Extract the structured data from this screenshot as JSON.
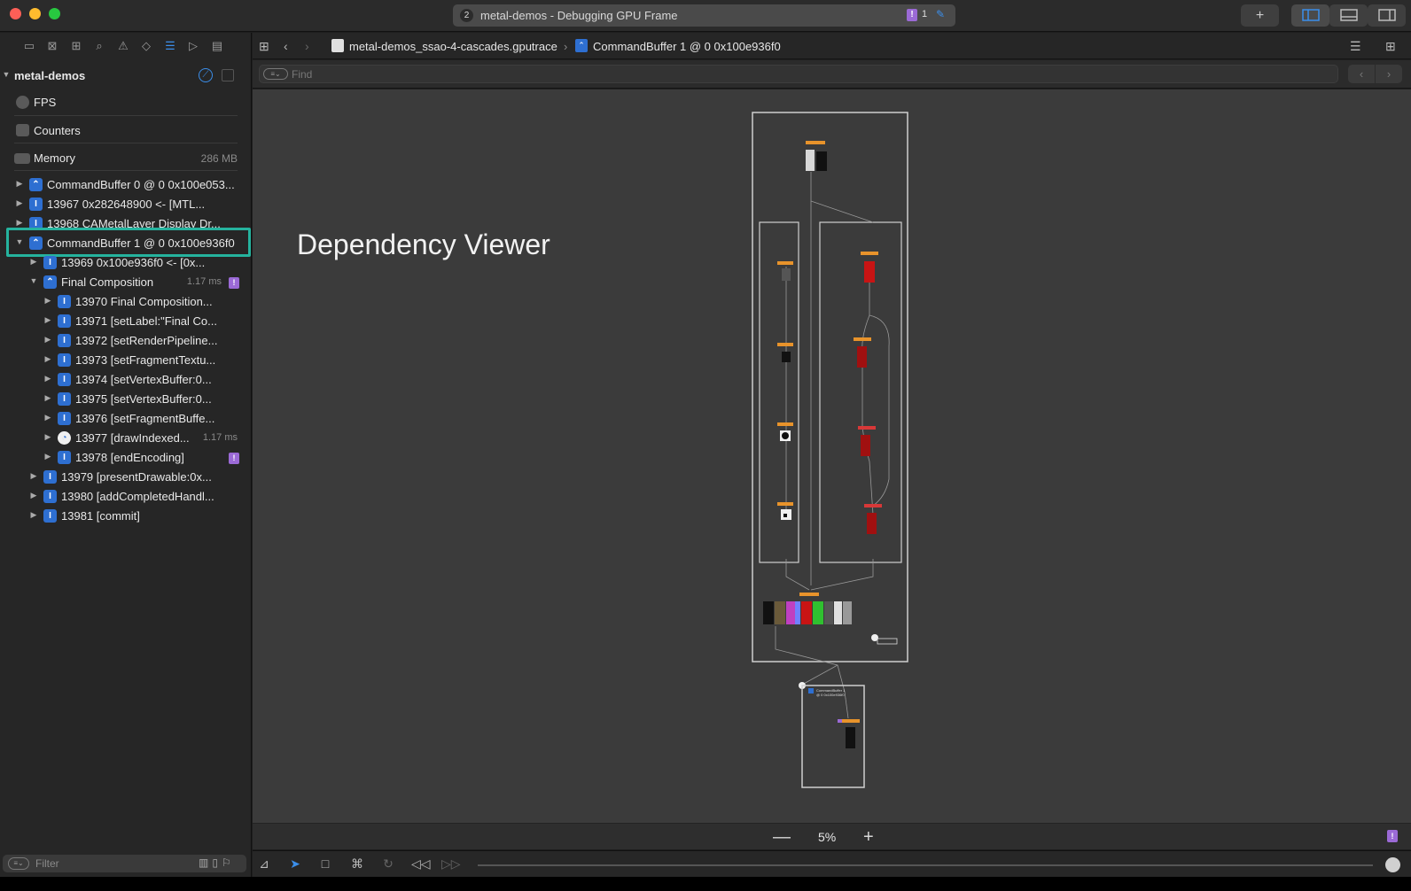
{
  "window": {
    "tab_number": "2",
    "title": "metal-demos - Debugging GPU Frame",
    "issue_count": "1"
  },
  "sidebar": {
    "root_label": "metal-demos",
    "fps_label": "FPS",
    "counters_label": "Counters",
    "memory_label": "Memory",
    "memory_value": "286 MB",
    "items": [
      {
        "label": "CommandBuffer 0 @ 0 0x100e053...",
        "icon": "command-buffer-icon",
        "meta": ""
      },
      {
        "label": "13967 0x282648900 <- [MTL...",
        "icon": "api-call-icon",
        "meta": ""
      },
      {
        "label": "13968 CAMetalLayer Display Dr...",
        "icon": "api-call-icon",
        "meta": ""
      },
      {
        "label": "CommandBuffer 1 @ 0 0x100e936f0",
        "icon": "command-buffer-icon",
        "meta": ""
      },
      {
        "label": "13969 0x100e936f0 <- [0x...",
        "icon": "api-call-icon",
        "meta": ""
      },
      {
        "label": "Final Composition",
        "icon": "encoder-icon",
        "meta": "1.17 ms"
      },
      {
        "label": "13970 Final Composition...",
        "icon": "api-call-icon",
        "meta": ""
      },
      {
        "label": "13971 [setLabel:\"Final Co...",
        "icon": "api-call-icon",
        "meta": ""
      },
      {
        "label": "13972 [setRenderPipeline...",
        "icon": "api-call-icon",
        "meta": ""
      },
      {
        "label": "13973 [setFragmentTextu...",
        "icon": "api-call-icon",
        "meta": ""
      },
      {
        "label": "13974 [setVertexBuffer:0...",
        "icon": "api-call-icon",
        "meta": ""
      },
      {
        "label": "13975 [setVertexBuffer:0...",
        "icon": "api-call-icon",
        "meta": ""
      },
      {
        "label": "13976 [setFragmentBuffe...",
        "icon": "api-call-icon",
        "meta": ""
      },
      {
        "label": "13977 [drawIndexed...",
        "icon": "draw-call-icon",
        "meta": "1.17 ms"
      },
      {
        "label": "13978 [endEncoding]",
        "icon": "api-call-icon",
        "meta": ""
      },
      {
        "label": "13979 [presentDrawable:0x...",
        "icon": "api-call-icon",
        "meta": ""
      },
      {
        "label": "13980 [addCompletedHandl...",
        "icon": "api-call-icon",
        "meta": ""
      },
      {
        "label": "13981 [commit]",
        "icon": "api-call-icon",
        "meta": ""
      }
    ],
    "filter_placeholder": "Filter"
  },
  "pathbar": {
    "file": "metal-demos_ssao-4-cascades.gputrace",
    "buffer": "CommandBuffer 1 @ 0 0x100e936f0"
  },
  "find": {
    "placeholder": "Find"
  },
  "canvas": {
    "overlay_title": "Dependency Viewer",
    "bottom_node_label_1": "CommandBuffer 1",
    "bottom_node_label_2": "@ 0 0x100e936f0"
  },
  "zoom": {
    "value": "5%",
    "minus": "—",
    "plus": "+"
  },
  "colors": {
    "accent": "#3b8eea",
    "highlight_box": "#25b39e",
    "issue": "#9b6ad6",
    "node_label": "#e8932b",
    "texture_red": "#c81414"
  }
}
